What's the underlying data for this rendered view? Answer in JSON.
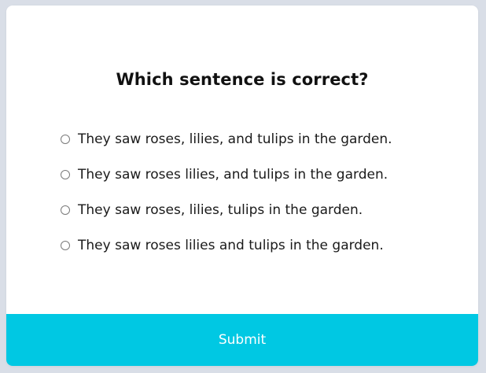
{
  "quiz": {
    "question": "Which sentence is correct?",
    "options": [
      {
        "label": "They saw roses, lilies, and tulips in the garden."
      },
      {
        "label": "They saw roses lilies, and tulips in the garden."
      },
      {
        "label": "They saw roses, lilies, tulips in the garden."
      },
      {
        "label": "They saw roses lilies and tulips in the garden."
      }
    ],
    "submit_label": "Submit"
  },
  "colors": {
    "page_background": "#d9dee7",
    "card_background": "#ffffff",
    "accent": "#00c8e3",
    "text": "#1a1a1a",
    "radio_border": "#7a7a7a"
  }
}
